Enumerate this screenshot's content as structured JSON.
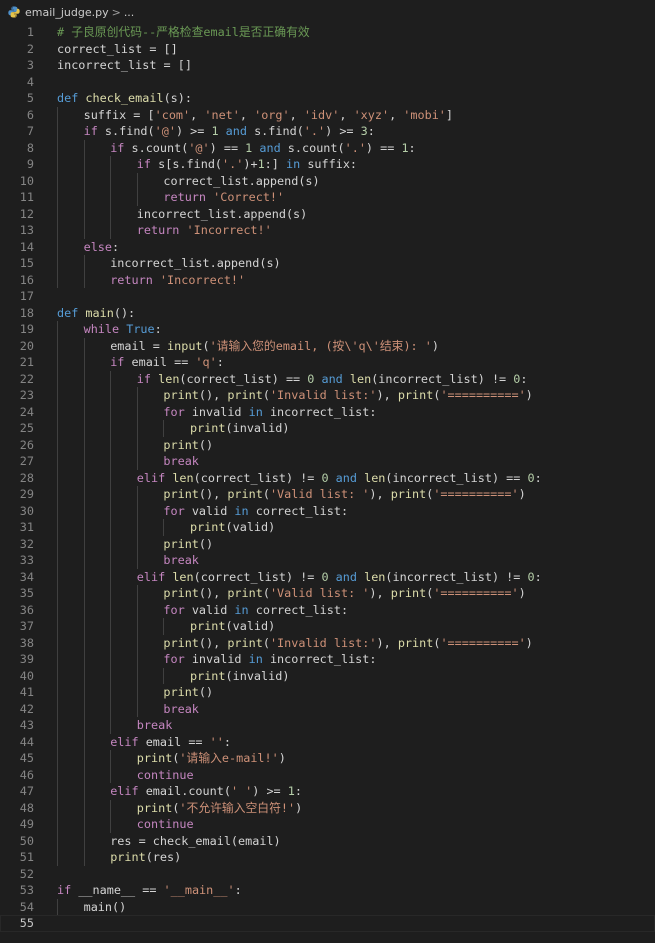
{
  "breadcrumb": {
    "file": "email_judge.py",
    "separator": ">",
    "more": "..."
  },
  "colors": {
    "background": "#1e1e1e",
    "keyword_control": "#c586c0",
    "keyword_decl": "#569cd6",
    "function": "#dcdcaa",
    "string": "#ce9178",
    "number": "#b5cea8",
    "comment": "#6a9955",
    "plain": "#d4d4d4",
    "line_number": "#858585"
  },
  "editor": {
    "current_line": 55,
    "lines": [
      {
        "n": "1",
        "i": 0,
        "t": [
          [
            "cm",
            "# 子良原创代码--严格检查email是否正确有效"
          ]
        ]
      },
      {
        "n": "2",
        "i": 0,
        "t": [
          [
            "tx",
            "correct_list = []"
          ]
        ]
      },
      {
        "n": "3",
        "i": 0,
        "t": [
          [
            "tx",
            "incorrect_list = []"
          ]
        ]
      },
      {
        "n": "4",
        "i": 0,
        "t": []
      },
      {
        "n": "5",
        "i": 0,
        "t": [
          [
            "dk",
            "def "
          ],
          [
            "fn",
            "check_email"
          ],
          [
            "tx",
            "(s):"
          ]
        ]
      },
      {
        "n": "6",
        "i": 1,
        "t": [
          [
            "tx",
            "suffix = ["
          ],
          [
            "st",
            "'com'"
          ],
          [
            "tx",
            ", "
          ],
          [
            "st",
            "'net'"
          ],
          [
            "tx",
            ", "
          ],
          [
            "st",
            "'org'"
          ],
          [
            "tx",
            ", "
          ],
          [
            "st",
            "'idv'"
          ],
          [
            "tx",
            ", "
          ],
          [
            "st",
            "'xyz'"
          ],
          [
            "tx",
            ", "
          ],
          [
            "st",
            "'mobi'"
          ],
          [
            "tx",
            "]"
          ]
        ]
      },
      {
        "n": "7",
        "i": 1,
        "t": [
          [
            "kw",
            "if "
          ],
          [
            "tx",
            "s.find("
          ],
          [
            "st",
            "'@'"
          ],
          [
            "tx",
            ") >= "
          ],
          [
            "nu",
            "1"
          ],
          [
            "dk",
            " and "
          ],
          [
            "tx",
            "s.find("
          ],
          [
            "st",
            "'.'"
          ],
          [
            "tx",
            ") >= "
          ],
          [
            "nu",
            "3"
          ],
          [
            "tx",
            ":"
          ]
        ]
      },
      {
        "n": "8",
        "i": 2,
        "t": [
          [
            "kw",
            "if "
          ],
          [
            "tx",
            "s.count("
          ],
          [
            "st",
            "'@'"
          ],
          [
            "tx",
            ") == "
          ],
          [
            "nu",
            "1"
          ],
          [
            "dk",
            " and "
          ],
          [
            "tx",
            "s.count("
          ],
          [
            "st",
            "'.'"
          ],
          [
            "tx",
            ") == "
          ],
          [
            "nu",
            "1"
          ],
          [
            "tx",
            ":"
          ]
        ]
      },
      {
        "n": "9",
        "i": 3,
        "t": [
          [
            "kw",
            "if "
          ],
          [
            "tx",
            "s[s.find("
          ],
          [
            "st",
            "'.'"
          ],
          [
            "tx",
            ")+"
          ],
          [
            "nu",
            "1"
          ],
          [
            "tx",
            ":]"
          ],
          [
            "dk",
            " in "
          ],
          [
            "tx",
            "suffix:"
          ]
        ]
      },
      {
        "n": "10",
        "i": 4,
        "t": [
          [
            "tx",
            "correct_list.append(s)"
          ]
        ]
      },
      {
        "n": "11",
        "i": 4,
        "t": [
          [
            "kw",
            "return "
          ],
          [
            "st",
            "'Correct!'"
          ]
        ]
      },
      {
        "n": "12",
        "i": 3,
        "t": [
          [
            "tx",
            "incorrect_list.append(s)"
          ]
        ]
      },
      {
        "n": "13",
        "i": 3,
        "t": [
          [
            "kw",
            "return "
          ],
          [
            "st",
            "'Incorrect!'"
          ]
        ]
      },
      {
        "n": "14",
        "i": 1,
        "t": [
          [
            "kw",
            "else"
          ],
          [
            "tx",
            ":"
          ]
        ]
      },
      {
        "n": "15",
        "i": 2,
        "t": [
          [
            "tx",
            "incorrect_list.append(s)"
          ]
        ]
      },
      {
        "n": "16",
        "i": 2,
        "t": [
          [
            "kw",
            "return "
          ],
          [
            "st",
            "'Incorrect!'"
          ]
        ]
      },
      {
        "n": "17",
        "i": 0,
        "t": []
      },
      {
        "n": "18",
        "i": 0,
        "t": [
          [
            "dk",
            "def "
          ],
          [
            "fn",
            "main"
          ],
          [
            "tx",
            "():"
          ]
        ]
      },
      {
        "n": "19",
        "i": 1,
        "t": [
          [
            "kw",
            "while "
          ],
          [
            "dk",
            "True"
          ],
          [
            "tx",
            ":"
          ]
        ]
      },
      {
        "n": "20",
        "i": 2,
        "t": [
          [
            "tx",
            "email = "
          ],
          [
            "fn",
            "input"
          ],
          [
            "tx",
            "("
          ],
          [
            "st",
            "'请输入您的email, (按\\'q\\'结束): '"
          ],
          [
            "tx",
            ")"
          ]
        ]
      },
      {
        "n": "21",
        "i": 2,
        "t": [
          [
            "kw",
            "if "
          ],
          [
            "tx",
            "email == "
          ],
          [
            "st",
            "'q'"
          ],
          [
            "tx",
            ":"
          ]
        ]
      },
      {
        "n": "22",
        "i": 3,
        "t": [
          [
            "kw",
            "if "
          ],
          [
            "fn",
            "len"
          ],
          [
            "tx",
            "(correct_list) == "
          ],
          [
            "nu",
            "0"
          ],
          [
            "dk",
            " and "
          ],
          [
            "fn",
            "len"
          ],
          [
            "tx",
            "(incorrect_list) != "
          ],
          [
            "nu",
            "0"
          ],
          [
            "tx",
            ":"
          ]
        ]
      },
      {
        "n": "23",
        "i": 4,
        "t": [
          [
            "fn",
            "print"
          ],
          [
            "tx",
            "(), "
          ],
          [
            "fn",
            "print"
          ],
          [
            "tx",
            "("
          ],
          [
            "st",
            "'Invalid list:'"
          ],
          [
            "tx",
            "), "
          ],
          [
            "fn",
            "print"
          ],
          [
            "tx",
            "("
          ],
          [
            "st",
            "'=========='"
          ],
          [
            "tx",
            ")"
          ]
        ]
      },
      {
        "n": "24",
        "i": 4,
        "t": [
          [
            "kw",
            "for "
          ],
          [
            "tx",
            "invalid"
          ],
          [
            "dk",
            " in "
          ],
          [
            "tx",
            "incorrect_list:"
          ]
        ]
      },
      {
        "n": "25",
        "i": 5,
        "t": [
          [
            "fn",
            "print"
          ],
          [
            "tx",
            "(invalid)"
          ]
        ]
      },
      {
        "n": "26",
        "i": 4,
        "t": [
          [
            "fn",
            "print"
          ],
          [
            "tx",
            "()"
          ]
        ]
      },
      {
        "n": "27",
        "i": 4,
        "t": [
          [
            "kw",
            "break"
          ]
        ]
      },
      {
        "n": "28",
        "i": 3,
        "t": [
          [
            "kw",
            "elif "
          ],
          [
            "fn",
            "len"
          ],
          [
            "tx",
            "(correct_list) != "
          ],
          [
            "nu",
            "0"
          ],
          [
            "dk",
            " and "
          ],
          [
            "fn",
            "len"
          ],
          [
            "tx",
            "(incorrect_list) == "
          ],
          [
            "nu",
            "0"
          ],
          [
            "tx",
            ":"
          ]
        ]
      },
      {
        "n": "29",
        "i": 4,
        "t": [
          [
            "fn",
            "print"
          ],
          [
            "tx",
            "(), "
          ],
          [
            "fn",
            "print"
          ],
          [
            "tx",
            "("
          ],
          [
            "st",
            "'Valid list: '"
          ],
          [
            "tx",
            "), "
          ],
          [
            "fn",
            "print"
          ],
          [
            "tx",
            "("
          ],
          [
            "st",
            "'=========='"
          ],
          [
            "tx",
            ")"
          ]
        ]
      },
      {
        "n": "30",
        "i": 4,
        "t": [
          [
            "kw",
            "for "
          ],
          [
            "tx",
            "valid"
          ],
          [
            "dk",
            " in "
          ],
          [
            "tx",
            "correct_list:"
          ]
        ]
      },
      {
        "n": "31",
        "i": 5,
        "t": [
          [
            "fn",
            "print"
          ],
          [
            "tx",
            "(valid)"
          ]
        ]
      },
      {
        "n": "32",
        "i": 4,
        "t": [
          [
            "fn",
            "print"
          ],
          [
            "tx",
            "()"
          ]
        ]
      },
      {
        "n": "33",
        "i": 4,
        "t": [
          [
            "kw",
            "break"
          ]
        ]
      },
      {
        "n": "34",
        "i": 3,
        "t": [
          [
            "kw",
            "elif "
          ],
          [
            "fn",
            "len"
          ],
          [
            "tx",
            "(correct_list) != "
          ],
          [
            "nu",
            "0"
          ],
          [
            "dk",
            " and "
          ],
          [
            "fn",
            "len"
          ],
          [
            "tx",
            "(incorrect_list) != "
          ],
          [
            "nu",
            "0"
          ],
          [
            "tx",
            ":"
          ]
        ]
      },
      {
        "n": "35",
        "i": 4,
        "t": [
          [
            "fn",
            "print"
          ],
          [
            "tx",
            "(), "
          ],
          [
            "fn",
            "print"
          ],
          [
            "tx",
            "("
          ],
          [
            "st",
            "'Valid list: '"
          ],
          [
            "tx",
            "), "
          ],
          [
            "fn",
            "print"
          ],
          [
            "tx",
            "("
          ],
          [
            "st",
            "'=========='"
          ],
          [
            "tx",
            ")"
          ]
        ]
      },
      {
        "n": "36",
        "i": 4,
        "t": [
          [
            "kw",
            "for "
          ],
          [
            "tx",
            "valid"
          ],
          [
            "dk",
            " in "
          ],
          [
            "tx",
            "correct_list:"
          ]
        ]
      },
      {
        "n": "37",
        "i": 5,
        "t": [
          [
            "fn",
            "print"
          ],
          [
            "tx",
            "(valid)"
          ]
        ]
      },
      {
        "n": "38",
        "i": 4,
        "t": [
          [
            "fn",
            "print"
          ],
          [
            "tx",
            "(), "
          ],
          [
            "fn",
            "print"
          ],
          [
            "tx",
            "("
          ],
          [
            "st",
            "'Invalid list:'"
          ],
          [
            "tx",
            "), "
          ],
          [
            "fn",
            "print"
          ],
          [
            "tx",
            "("
          ],
          [
            "st",
            "'=========='"
          ],
          [
            "tx",
            ")"
          ]
        ]
      },
      {
        "n": "39",
        "i": 4,
        "t": [
          [
            "kw",
            "for "
          ],
          [
            "tx",
            "invalid"
          ],
          [
            "dk",
            " in "
          ],
          [
            "tx",
            "incorrect_list:"
          ]
        ]
      },
      {
        "n": "40",
        "i": 5,
        "t": [
          [
            "fn",
            "print"
          ],
          [
            "tx",
            "(invalid)"
          ]
        ]
      },
      {
        "n": "41",
        "i": 4,
        "t": [
          [
            "fn",
            "print"
          ],
          [
            "tx",
            "()"
          ]
        ]
      },
      {
        "n": "42",
        "i": 4,
        "t": [
          [
            "kw",
            "break"
          ]
        ]
      },
      {
        "n": "43",
        "i": 3,
        "t": [
          [
            "kw",
            "break"
          ]
        ]
      },
      {
        "n": "44",
        "i": 2,
        "t": [
          [
            "kw",
            "elif "
          ],
          [
            "tx",
            "email == "
          ],
          [
            "st",
            "''"
          ],
          [
            "tx",
            ":"
          ]
        ]
      },
      {
        "n": "45",
        "i": 3,
        "t": [
          [
            "fn",
            "print"
          ],
          [
            "tx",
            "("
          ],
          [
            "st",
            "'请输入e-mail!'"
          ],
          [
            "tx",
            ")"
          ]
        ]
      },
      {
        "n": "46",
        "i": 3,
        "t": [
          [
            "kw",
            "continue"
          ]
        ]
      },
      {
        "n": "47",
        "i": 2,
        "t": [
          [
            "kw",
            "elif "
          ],
          [
            "tx",
            "email.count("
          ],
          [
            "st",
            "' '"
          ],
          [
            "tx",
            ") >= "
          ],
          [
            "nu",
            "1"
          ],
          [
            "tx",
            ":"
          ]
        ]
      },
      {
        "n": "48",
        "i": 3,
        "t": [
          [
            "fn",
            "print"
          ],
          [
            "tx",
            "("
          ],
          [
            "st",
            "'不允许输入空白符!'"
          ],
          [
            "tx",
            ")"
          ]
        ]
      },
      {
        "n": "49",
        "i": 3,
        "t": [
          [
            "kw",
            "continue"
          ]
        ]
      },
      {
        "n": "50",
        "i": 2,
        "t": [
          [
            "tx",
            "res = check_email(email)"
          ]
        ]
      },
      {
        "n": "51",
        "i": 2,
        "t": [
          [
            "fn",
            "print"
          ],
          [
            "tx",
            "(res)"
          ]
        ]
      },
      {
        "n": "52",
        "i": 0,
        "t": []
      },
      {
        "n": "53",
        "i": 0,
        "t": [
          [
            "kw",
            "if "
          ],
          [
            "tx",
            "__name__ == "
          ],
          [
            "st",
            "'__main__'"
          ],
          [
            "tx",
            ":"
          ]
        ]
      },
      {
        "n": "54",
        "i": 1,
        "t": [
          [
            "tx",
            "main()"
          ]
        ]
      },
      {
        "n": "55",
        "i": 0,
        "t": []
      }
    ]
  }
}
